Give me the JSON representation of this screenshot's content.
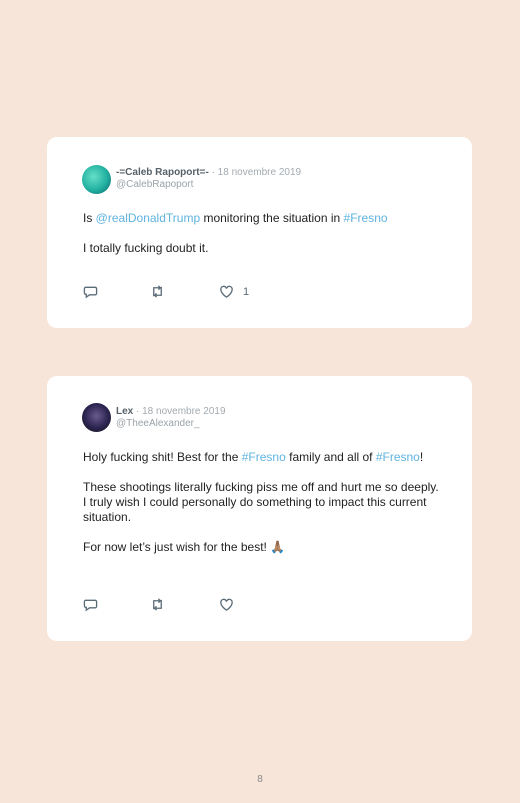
{
  "tweets": [
    {
      "name": "-=Caleb Rapoport=-",
      "date": " · 18 novembre 2019",
      "handle": "@CalebRapoport",
      "p1_a": "Is ",
      "p1_link1": "@realDonaldTrump",
      "p1_b": " monitoring the situation in ",
      "p1_link2": "#Fresno",
      "p2": "I totally fucking doubt it.",
      "like_count": "1",
      "icons": [
        "reply-icon",
        "retweet-icon",
        "heart-icon"
      ]
    },
    {
      "name": "Lex",
      "date": " · 18 novembre 2019",
      "handle": "@TheeAlexander_",
      "p1_a": "Holy fucking shit! Best for the ",
      "p1_link1": "#Fresno",
      "p1_b": " family and all of ",
      "p1_link2": "#Fresno",
      "p1_c": "!",
      "p2": "These shootings literally fucking piss me off and hurt me so deeply. I truly wish I could personally do something to impact this current situation.",
      "p3": "For now let’s just wish for the best! 🙏🏽",
      "icons": [
        "reply-icon",
        "retweet-icon",
        "heart-icon"
      ]
    }
  ],
  "page_number": "8"
}
